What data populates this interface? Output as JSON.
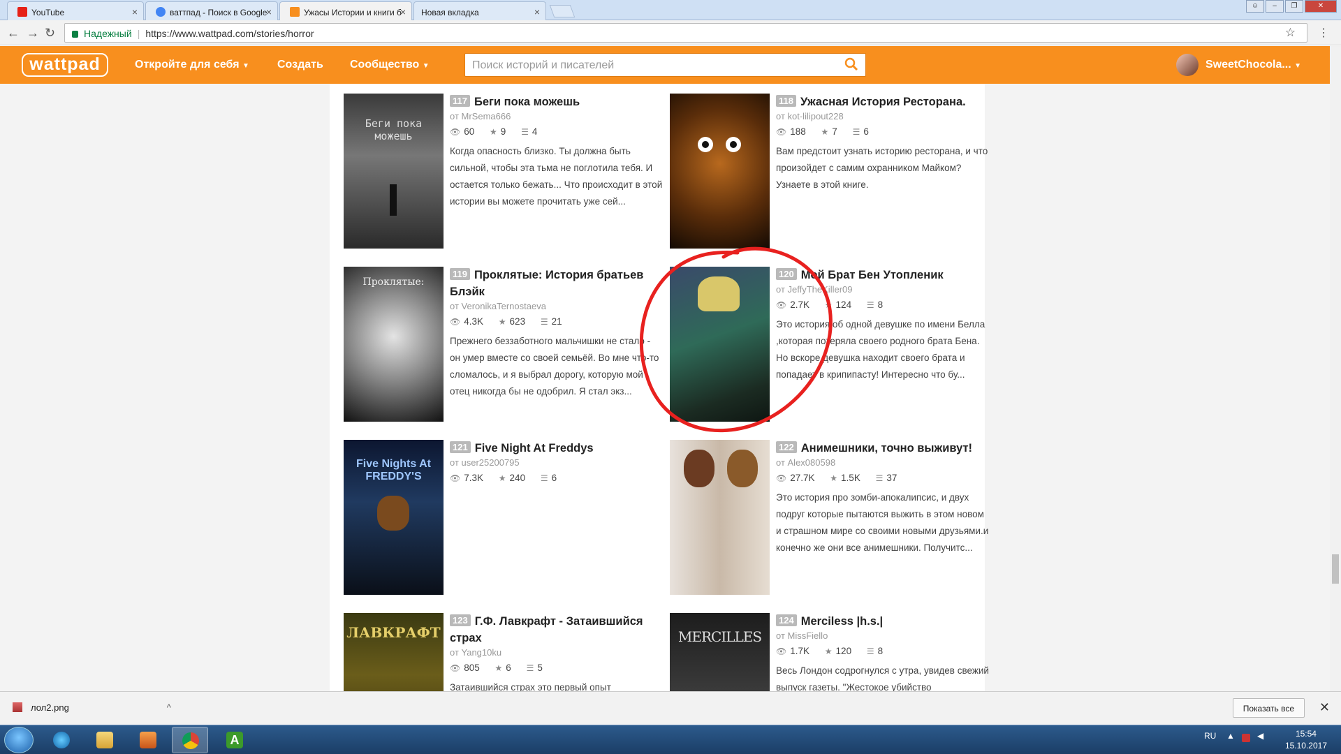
{
  "browser": {
    "tabs": [
      {
        "label": "YouTube",
        "icon": "youtube-icon"
      },
      {
        "label": "ваттпад - Поиск в Google",
        "icon": "google-icon"
      },
      {
        "label": "Ужасы Истории и книги б",
        "icon": "wattpad-icon"
      },
      {
        "label": "Новая вкладка",
        "icon": "blank-icon"
      }
    ],
    "secure_label": "Надежный",
    "url": "https://www.wattpad.com/stories/horror"
  },
  "header": {
    "logo": "wattpad",
    "nav": [
      {
        "label": "Откройте для себя"
      },
      {
        "label": "Создать"
      },
      {
        "label": "Сообщество"
      }
    ],
    "search_placeholder": "Поиск историй и писателей",
    "username": "SweetChocola..."
  },
  "stories": [
    {
      "rank": "117",
      "title": "Беги пока можешь",
      "author": "от MrSema666",
      "reads": "60",
      "votes": "9",
      "parts": "4",
      "desc": "Когда опасность близко. Ты должна быть сильной, чтобы эта тьма не поглотила тебя. И остается только бежать... Что происходит в этой истории вы можете прочитать уже сей..."
    },
    {
      "rank": "118",
      "title": "Ужасная История Ресторана.",
      "author": "от kot-lilipout228",
      "reads": "188",
      "votes": "7",
      "parts": "6",
      "desc": "Вам предстоит узнать историю ресторана, и что произойдет с самим охранником Майком? Узнаете в этой книге."
    },
    {
      "rank": "119",
      "title": "Проклятые: История братьев Блэйк",
      "author": "от VeronikaTernostaeva",
      "reads": "4.3K",
      "votes": "623",
      "parts": "21",
      "desc": "Прежнего беззаботного мальчишки не стало - он умер вместе со своей семьёй. Во мне что-то сломалось, и я выбрал дорогу, которую мой отец никогда бы не одобрил. Я стал экз..."
    },
    {
      "rank": "120",
      "title": "Мой Брат Бен Утопленик",
      "author": "от JeffyTheKiller09",
      "reads": "2.7K",
      "votes": "124",
      "parts": "8",
      "desc": "Это история об одной девушке по имени Белла ,которая потеряла своего родного брата Бена. Но вскоре девушка находит своего брата и попадает в крипипасту! Интересно что бу..."
    },
    {
      "rank": "121",
      "title": "Five Night At Freddys",
      "author": "от user25200795",
      "reads": "7.3K",
      "votes": "240",
      "parts": "6",
      "desc": ""
    },
    {
      "rank": "122",
      "title": "Анимешники, точно выживут!",
      "author": "от Alex080598",
      "reads": "27.7K",
      "votes": "1.5K",
      "parts": "37",
      "desc": "Это история про зомби-апокалипсис, и двух подруг которые пытаются выжить в этом новом и страшном мире со своими новыми друзьями.и конечно же они все анимешники. Получитс..."
    },
    {
      "rank": "123",
      "title": "Г.Ф. Лавкрафт - Затаившийся страх",
      "author": "от Yang10ku",
      "reads": "805",
      "votes": "6",
      "parts": "5",
      "desc": "Затаившийся страх это первый опыт"
    },
    {
      "rank": "124",
      "title": "Merciless |h.s.|",
      "author": "от MissFiello",
      "reads": "1.7K",
      "votes": "120",
      "parts": "8",
      "desc": "Весь Лондон содрогнулся с утра, увидев свежий выпуск газеты. \"Жестокое убийство"
    }
  ],
  "covers": [
    {
      "text": "Беги пока можешь"
    },
    {
      "text": ""
    },
    {
      "text": "Проклятые:"
    },
    {
      "text": ""
    },
    {
      "text": "Five Nights At FREDDY'S"
    },
    {
      "text": ""
    },
    {
      "text": "ЛАВКРАФТ"
    },
    {
      "text": "MERCILLES"
    }
  ],
  "download": {
    "file": "лол2.png",
    "show_all": "Показать все"
  },
  "taskbar": {
    "lang": "RU",
    "time": "15:54",
    "date": "15.10.2017"
  },
  "colors": {
    "brand": "#f88f1e",
    "annotation": "#e8211f"
  }
}
